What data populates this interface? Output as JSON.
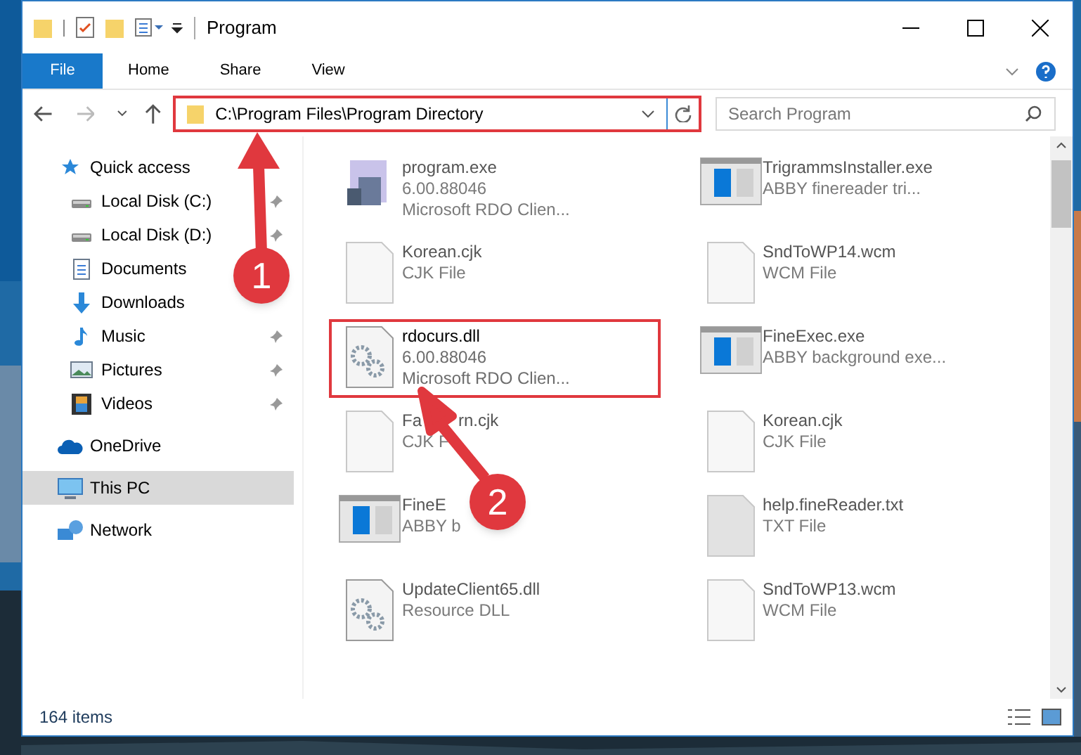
{
  "window": {
    "title": "Program"
  },
  "ribbon_tabs": [
    {
      "label": "File",
      "selected": true
    },
    {
      "label": "Home",
      "selected": false
    },
    {
      "label": "Share",
      "selected": false
    },
    {
      "label": "View",
      "selected": false
    }
  ],
  "address_bar": {
    "path": "C:\\Program Files\\Program Directory",
    "highlighted": true
  },
  "search": {
    "placeholder": "Search Program"
  },
  "sidebar": {
    "items": [
      {
        "label": "Quick access",
        "kind": "star",
        "selected": false,
        "children": [
          {
            "label": "Local Disk (C:)",
            "kind": "disk",
            "pinned": true,
            "selected": false
          },
          {
            "label": "Local Disk (D:)",
            "kind": "disk",
            "pinned": true,
            "selected": false
          },
          {
            "label": "Documents",
            "kind": "documents",
            "pinned": false,
            "selected": false
          },
          {
            "label": "Downloads",
            "kind": "downloads",
            "pinned": false,
            "selected": false
          },
          {
            "label": "Music",
            "kind": "music",
            "pinned": true,
            "selected": false
          },
          {
            "label": "Pictures",
            "kind": "pictures",
            "pinned": true,
            "selected": false
          },
          {
            "label": "Videos",
            "kind": "videos",
            "pinned": true,
            "selected": false
          }
        ]
      },
      {
        "label": "OneDrive",
        "kind": "cloud",
        "selected": false
      },
      {
        "label": "This PC",
        "kind": "pc",
        "selected": true
      },
      {
        "label": "Network",
        "kind": "network",
        "selected": false
      }
    ]
  },
  "files": [
    {
      "name": "program.exe",
      "lines": [
        "6.00.88046",
        "Microsoft RDO Clien..."
      ],
      "kind": "setup",
      "highlighted": false
    },
    {
      "name": "TrigrammsInstaller.exe",
      "lines": [
        "ABBY finereader tri..."
      ],
      "kind": "app",
      "highlighted": false
    },
    {
      "name": "Korean.cjk",
      "lines": [
        "CJK File"
      ],
      "kind": "blank",
      "highlighted": false
    },
    {
      "name": "SndToWP14.wcm",
      "lines": [
        "WCM File"
      ],
      "kind": "blank",
      "highlighted": false
    },
    {
      "name": "rdocurs.dll",
      "lines": [
        "6.00.88046",
        "Microsoft RDO Clien..."
      ],
      "kind": "gears",
      "highlighted": true
    },
    {
      "name": "FineExec.exe",
      "lines": [
        "ABBY background exe..."
      ],
      "kind": "app",
      "highlighted": false
    },
    {
      "name": "Fa",
      "name_tail": "rn.cjk",
      "lines": [
        "CJK F"
      ],
      "kind": "blank",
      "highlighted": false
    },
    {
      "name": "Korean.cjk",
      "lines": [
        "CJK File"
      ],
      "kind": "blank",
      "highlighted": false
    },
    {
      "name": "FineE",
      "lines": [
        "ABBY b"
      ],
      "kind": "app",
      "highlighted": false
    },
    {
      "name": "help.fineReader.txt",
      "lines": [
        "TXT File"
      ],
      "kind": "text",
      "highlighted": false
    },
    {
      "name": "UpdateClient65.dll",
      "lines": [
        "Resource DLL"
      ],
      "kind": "gears",
      "highlighted": false
    },
    {
      "name": "SndToWP13.wcm",
      "lines": [
        "WCM File"
      ],
      "kind": "blank",
      "highlighted": false
    }
  ],
  "status_bar": {
    "count": "164 items"
  },
  "annotations": [
    {
      "number": "1"
    },
    {
      "number": "2"
    }
  ]
}
